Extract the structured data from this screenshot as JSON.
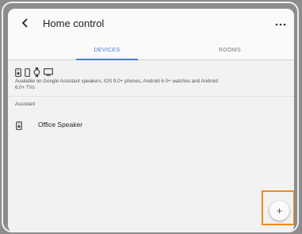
{
  "appbar": {
    "title": "Home control",
    "back_icon": "back-arrow-icon",
    "more_icon": "more-dots-icon"
  },
  "tabs": [
    {
      "label": "DEVICES",
      "selected": true
    },
    {
      "label": "ROOMS",
      "selected": false
    }
  ],
  "supported_device_icons": [
    "speaker-icon",
    "phone-icon",
    "watch-icon",
    "tv-icon"
  ],
  "availability_text": "Available on Google Assistant speakers, iOS 9.0+ phones, Android 6.0+ watches and Android 6.0+ TVs",
  "section_label": "Assistant",
  "devices": [
    {
      "name": "Office Speaker",
      "icon": "speaker-icon"
    }
  ],
  "fab": {
    "label": "+",
    "icon": "add-icon"
  },
  "colors": {
    "accent": "#4a7bd0",
    "highlight": "#ef8b1f",
    "background": "#f2f2f2"
  }
}
